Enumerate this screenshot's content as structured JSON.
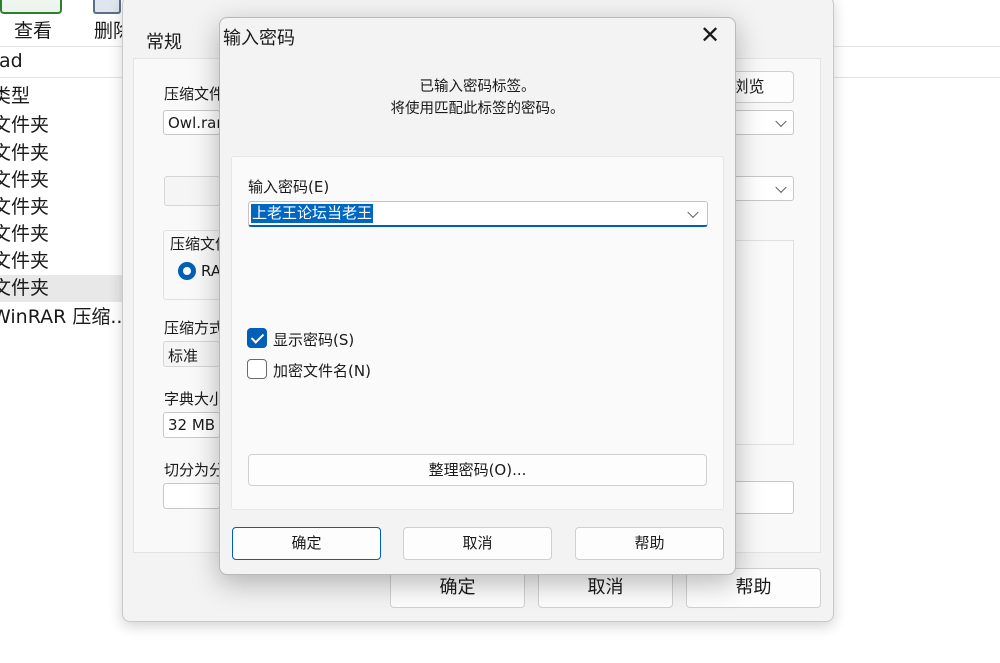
{
  "explorer": {
    "toolbar": {
      "view_label": "查看",
      "delete_label": "删除"
    },
    "address_fragment": "ad",
    "list_items": [
      "类型",
      "文件夹",
      "文件夹",
      "文件夹",
      "文件夹",
      "文件夹",
      "文件夹",
      "文件夹",
      "WinRAR 压缩..."
    ]
  },
  "archive_dialog": {
    "tab_general": "常规",
    "archive_name_label": "压缩文件名",
    "archive_name_value": "Owl.rar",
    "browse_button": "浏览(B)...",
    "format_group_label": "压缩文件格式",
    "format_rar": "RAR",
    "method_label": "压缩方式",
    "method_value": "标准",
    "dict_label": "字典大小",
    "dict_value": "32 MB",
    "split_label": "切分为分卷",
    "ok": "确定",
    "cancel": "取消",
    "help": "帮助"
  },
  "password_dialog": {
    "title": "输入密码",
    "message_line1": "已输入密码标签。",
    "message_line2": "将使用匹配此标签的密码。",
    "password_label": "输入密码(E)",
    "password_value": "上老王论坛当老王",
    "show_password": {
      "label": "显示密码(S)",
      "checked": true
    },
    "encrypt_names": {
      "label": "加密文件名(N)",
      "checked": false
    },
    "organize_button": "整理密码(O)...",
    "ok": "确定",
    "cancel": "取消",
    "help": "帮助"
  },
  "colors": {
    "accent": "#005fb8",
    "selection": "#0067c0",
    "dialog_bg": "#f3f3f3"
  }
}
